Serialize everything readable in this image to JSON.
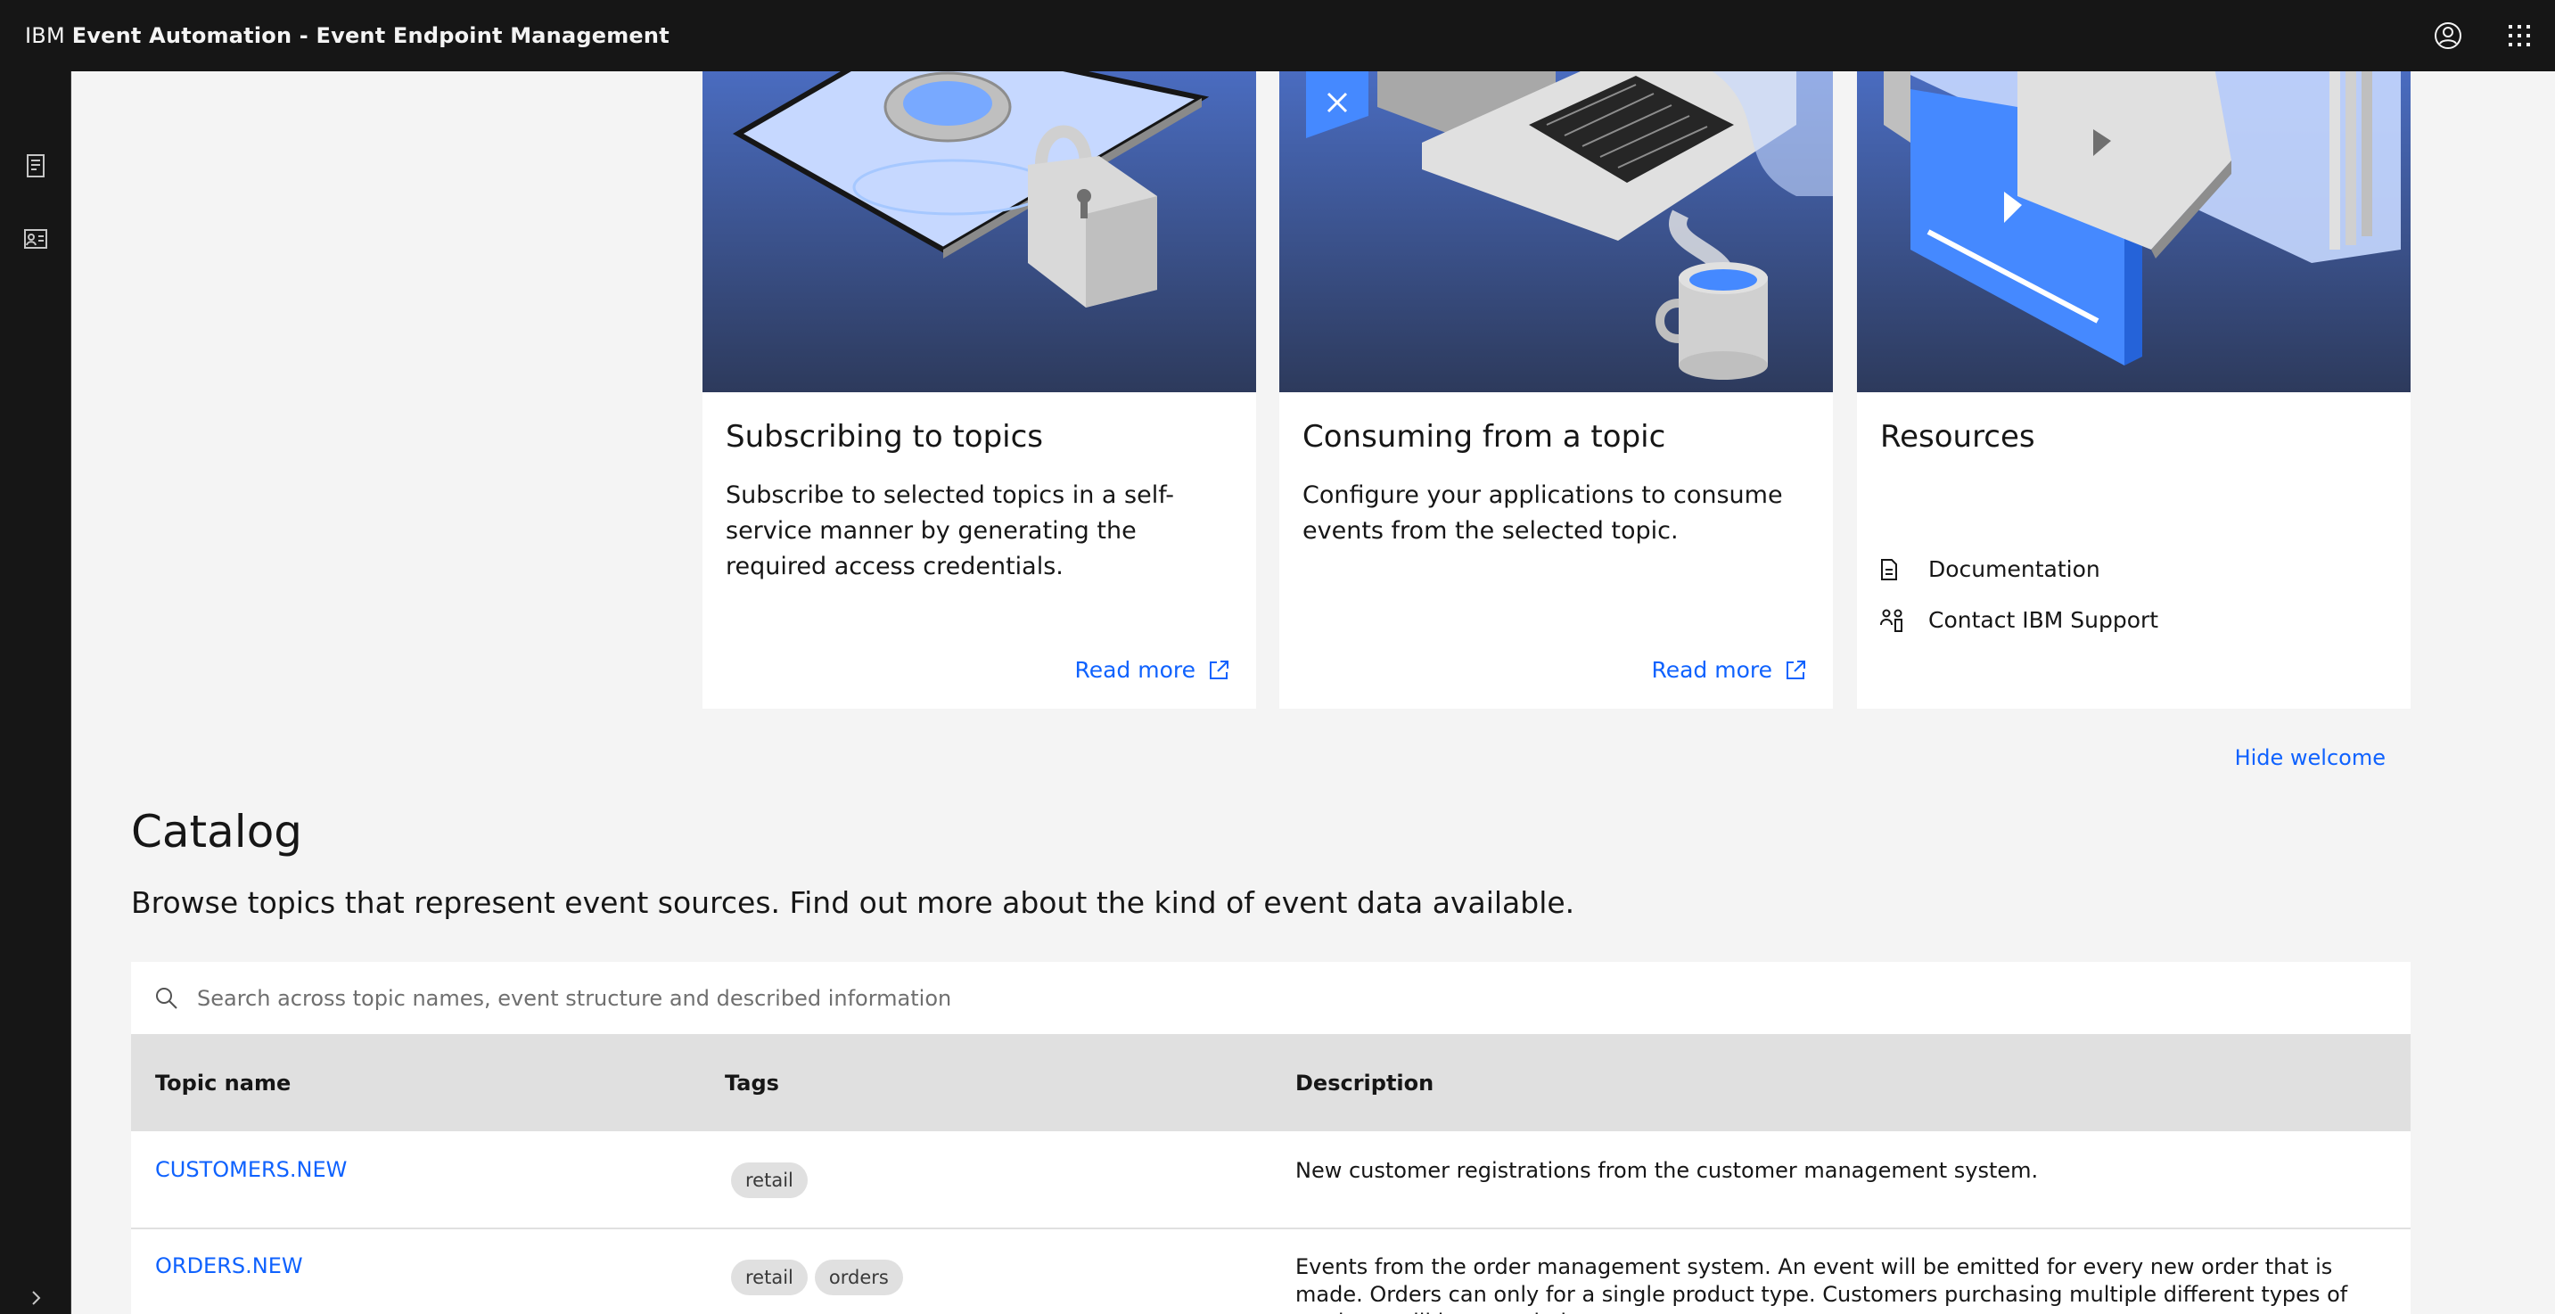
{
  "header": {
    "brand_ibm": "IBM",
    "brand_product": "Event Automation - Event Endpoint Management",
    "user_icon": "user-avatar-icon",
    "switcher_icon": "app-switcher-icon"
  },
  "sidenav": {
    "items": [
      {
        "icon": "catalog-icon"
      },
      {
        "icon": "subscriptions-icon"
      }
    ],
    "expand_icon": "chevron-right-icon"
  },
  "welcome": {
    "cards": [
      {
        "title": "Subscribing to topics",
        "description": "Subscribe to selected topics in a self-service manner by generating the required access credentials.",
        "link_label": "Read more",
        "link_icon": "launch-icon"
      },
      {
        "title": "Consuming from a topic",
        "description": "Configure your applications to consume events from the selected topic.",
        "link_label": "Read more",
        "link_icon": "launch-icon"
      },
      {
        "title": "Resources",
        "links": [
          {
            "label": "Documentation",
            "icon": "document-icon"
          },
          {
            "label": "Contact IBM Support",
            "icon": "support-icon"
          }
        ]
      }
    ],
    "hide_label": "Hide welcome"
  },
  "catalog": {
    "title": "Catalog",
    "subtitle": "Browse topics that represent event sources. Find out more about the kind of event data available.",
    "search_placeholder": "Search across topic names, event structure and described information",
    "columns": [
      "Topic name",
      "Tags",
      "Description"
    ],
    "rows": [
      {
        "topic": "CUSTOMERS.NEW",
        "tags": [
          "retail"
        ],
        "description": "New customer registrations from the customer management system."
      },
      {
        "topic": "ORDERS.NEW",
        "tags": [
          "retail",
          "orders"
        ],
        "description": "Events from the order management system. An event will be emitted for every new order that is made. Orders can only for a single product type. Customers purchasing multiple different types of products will be recorded as"
      }
    ]
  },
  "colors": {
    "header_bg": "#161616",
    "page_bg": "#f4f4f4",
    "link": "#0f62fe",
    "table_header_bg": "#e0e0e0",
    "illustration_bg": "#3b5aa0"
  }
}
